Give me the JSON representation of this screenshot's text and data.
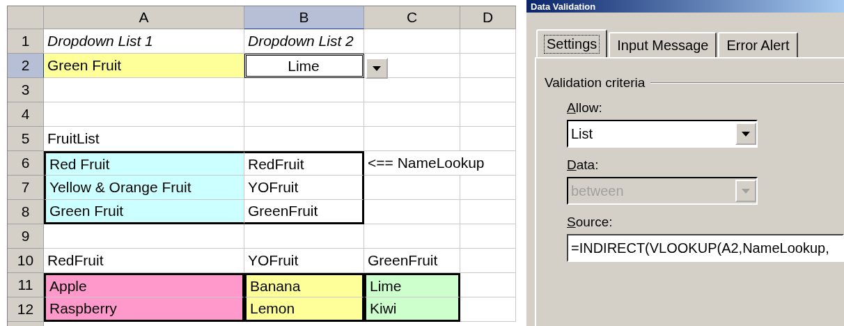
{
  "sheet": {
    "columns": [
      {
        "label": "A",
        "selected": false
      },
      {
        "label": "B",
        "selected": true
      },
      {
        "label": "C",
        "selected": false
      },
      {
        "label": "D",
        "selected": false
      }
    ],
    "rows": [
      {
        "number": "1",
        "selected": false,
        "cells": [
          {
            "text": "Dropdown List 1",
            "kind": "italic"
          },
          {
            "text": "Dropdown List 2",
            "kind": "italic"
          },
          null,
          null
        ]
      },
      {
        "number": "2",
        "selected": true,
        "cells": [
          {
            "text": "Green Fruit",
            "color": "#ffff99"
          },
          {
            "text": "Lime",
            "centered": true,
            "active": true
          },
          null,
          null
        ]
      },
      {
        "number": "3",
        "selected": false,
        "cells": [
          null,
          null,
          null,
          null
        ]
      },
      {
        "number": "4",
        "selected": false,
        "cells": [
          null,
          null,
          null,
          null
        ]
      },
      {
        "number": "5",
        "selected": false,
        "cells": [
          {
            "text": "FruitList"
          },
          null,
          null,
          null
        ]
      },
      {
        "number": "6",
        "selected": false,
        "cells": [
          {
            "text": "Red Fruit",
            "color": "#ccffff",
            "frame": {
              "top": true,
              "left": true
            }
          },
          {
            "text": "RedFruit",
            "frame": {
              "top": true,
              "right": true
            }
          },
          {
            "text": "<== NameLookup",
            "spills_right": true
          }
        ]
      },
      {
        "number": "7",
        "selected": false,
        "cells": [
          {
            "text": "Yellow & Orange Fruit",
            "color": "#ccffff",
            "frame": {
              "left": true
            }
          },
          {
            "text": "YOFruit",
            "frame": {
              "right": true
            }
          },
          null,
          null
        ]
      },
      {
        "number": "8",
        "selected": false,
        "cells": [
          {
            "text": "Green Fruit",
            "color": "#ccffff",
            "frame": {
              "left": true,
              "bottom": true
            }
          },
          {
            "text": "GreenFruit",
            "frame": {
              "right": true,
              "bottom": true
            }
          },
          null,
          null
        ]
      },
      {
        "number": "9",
        "selected": false,
        "cells": [
          null,
          null,
          null,
          null
        ]
      },
      {
        "number": "10",
        "selected": false,
        "cells": [
          {
            "text": "RedFruit"
          },
          {
            "text": "YOFruit"
          },
          {
            "text": "GreenFruit"
          },
          null
        ]
      },
      {
        "number": "11",
        "selected": false,
        "cells": [
          {
            "text": "Apple",
            "color": "#ff99cc",
            "frame": {
              "top": true,
              "left": true,
              "right": true
            }
          },
          {
            "text": "Banana",
            "color": "#ffff99",
            "frame": {
              "top": true,
              "left": true,
              "right": true
            }
          },
          {
            "text": "Lime",
            "color": "#ccffcc",
            "frame": {
              "top": true,
              "left": true,
              "right": true
            }
          },
          null
        ]
      },
      {
        "number": "12",
        "selected": false,
        "cells": [
          {
            "text": "Raspberry",
            "color": "#ff99cc",
            "frame": {
              "bottom": true,
              "left": true,
              "right": true
            }
          },
          {
            "text": "Lemon",
            "color": "#ffff99",
            "frame": {
              "bottom": true,
              "left": true,
              "right": true
            }
          },
          {
            "text": "Kiwi",
            "color": "#ccffcc",
            "frame": {
              "bottom": true,
              "left": true,
              "right": true
            }
          },
          null
        ]
      }
    ]
  },
  "dialog": {
    "title": "Data Validation",
    "tabs": [
      {
        "label": "Settings",
        "selected": true
      },
      {
        "label": "Input Message",
        "selected": false
      },
      {
        "label": "Error Alert",
        "selected": false
      }
    ],
    "group": "Validation criteria",
    "fields": [
      {
        "kind": "combo",
        "label": "Allow:",
        "value": "List",
        "disabled": false
      },
      {
        "kind": "combo",
        "label": "Data:",
        "value": "between",
        "disabled": true
      },
      {
        "kind": "text",
        "label": "Source:",
        "value": "=INDIRECT(VLOOKUP(A2,NameLookup,"
      }
    ]
  }
}
